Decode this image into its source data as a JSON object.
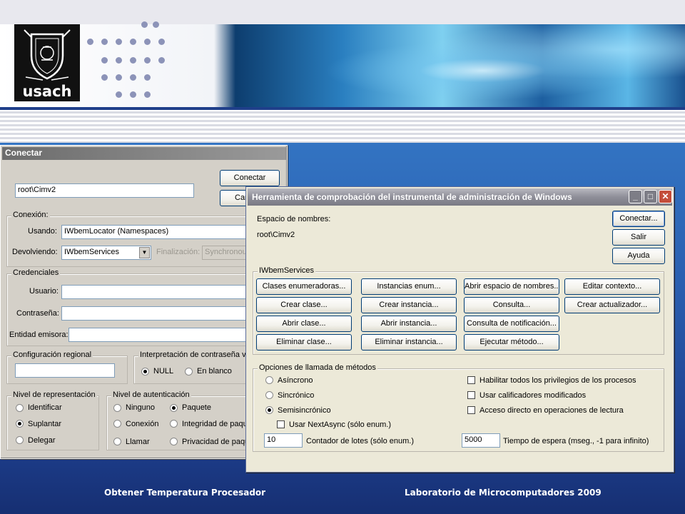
{
  "logo": {
    "text": "usach"
  },
  "conectar": {
    "title": "Conectar",
    "namespace_value": "root\\Cimv2",
    "connect_button": "Conectar",
    "cancel_button": "Can",
    "conexion": {
      "title": "Conexión:",
      "usando_label": "Usando:",
      "usando_value": "IWbemLocator (Namespaces)",
      "devolviendo_label": "Devolviendo:",
      "devolviendo_value": "IWbemServices",
      "finalizacion_label": "Finalización:",
      "finalizacion_value": "Synchronous"
    },
    "credenciales": {
      "title": "Credenciales",
      "usuario_label": "Usuario:",
      "contrasena_label": "Contraseña:",
      "entidad_label": "Entidad emisora:"
    },
    "config_regional": {
      "title": "Configuración regional"
    },
    "interpretacion": {
      "title": "Interpretación de contraseña va",
      "null_label": "NULL",
      "blanco_label": "En blanco"
    },
    "representacion": {
      "title": "Nivel de representación",
      "options": [
        "Identificar",
        "Suplantar",
        "Delegar"
      ]
    },
    "autenticacion": {
      "title": "Nivel de autenticación",
      "col1": [
        "Ninguno",
        "Conexión",
        "Llamar"
      ],
      "col2": [
        "Paquete",
        "Integridad de paqu",
        "Privacidad de paqu"
      ]
    }
  },
  "wmi": {
    "title": "Herramienta de comprobación del instrumental de administración de Windows",
    "namespace_label": "Espacio de nombres:",
    "namespace_value": "root\\Cimv2",
    "buttons": {
      "connect": "Conectar...",
      "exit": "Salir",
      "help": "Ayuda"
    },
    "iwbem": {
      "title": "IWbemServices",
      "grid": [
        [
          "Clases enumeradoras...",
          "Instancias enum...",
          "Abrir espacio de nombres...",
          "Editar contexto..."
        ],
        [
          "Crear clase...",
          "Crear instancia...",
          "Consulta...",
          "Crear actualizador..."
        ],
        [
          "Abrir clase...",
          "Abrir instancia...",
          "Consulta de notificación...",
          ""
        ],
        [
          "Eliminar clase...",
          "Eliminar instancia...",
          "Ejecutar método...",
          ""
        ]
      ]
    },
    "opciones": {
      "title": "Opciones de llamada de métodos",
      "radios": [
        "Asíncrono",
        "Sincrónico",
        "Semisincrónico"
      ],
      "checks": [
        "Habilitar todos los privilegios de los procesos",
        "Usar calificadores modificados",
        "Acceso directo en operaciones de lectura"
      ],
      "next_async": "Usar NextAsync (sólo enum.)",
      "batch_value": "10",
      "batch_label": "Contador de lotes (sólo enum.)",
      "timeout_value": "5000",
      "timeout_label": "Tiempo de espera (mseg., -1 para infinito)"
    }
  },
  "footer": {
    "left": "Obtener Temperatura Procesador",
    "right": "Laboratorio de Microcomputadores 2009"
  }
}
